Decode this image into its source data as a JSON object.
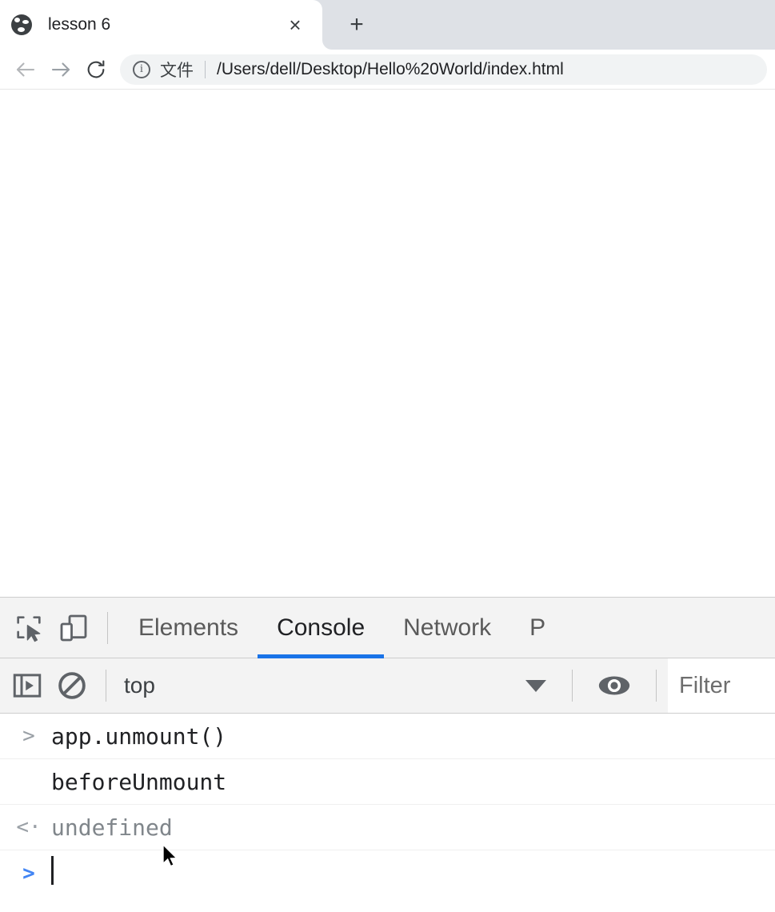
{
  "browser": {
    "tab": {
      "title": "lesson 6",
      "favicon": "globe-icon",
      "close_label": "×"
    },
    "new_tab_label": "+",
    "nav": {
      "back_label": "←",
      "forward_label": "→",
      "reload_label": "⟳"
    },
    "omnibox": {
      "info_icon": "info-circle-icon",
      "scheme_label": "文件",
      "url": "/Users/dell/Desktop/Hello%20World/index.html"
    }
  },
  "devtools": {
    "icons": {
      "inspect": "inspect-element-icon",
      "device": "device-toolbar-icon",
      "sidebar": "console-sidebar-icon",
      "clear": "clear-console-icon",
      "eye": "live-expression-eye-icon"
    },
    "tabs": [
      {
        "label": "Elements",
        "active": false
      },
      {
        "label": "Console",
        "active": true
      },
      {
        "label": "Network",
        "active": false
      },
      {
        "label": "P",
        "active": false
      }
    ],
    "filterbar": {
      "context": "top",
      "caret": "chevron-down-icon",
      "filter_placeholder": "Filter"
    },
    "console_rows": [
      {
        "type": "input",
        "gutter": ">",
        "text": "app.unmount()"
      },
      {
        "type": "log",
        "gutter": "",
        "text": "beforeUnmount"
      },
      {
        "type": "result",
        "gutter": "<·",
        "text": "undefined"
      },
      {
        "type": "prompt",
        "gutter": ">",
        "text": ""
      }
    ]
  },
  "colors": {
    "accent_blue": "#1a73e8",
    "prompt_blue": "#4285f4",
    "tabstrip_bg": "#dee1e6",
    "devtools_bg": "#f3f3f3",
    "result_grey": "#80868b"
  }
}
